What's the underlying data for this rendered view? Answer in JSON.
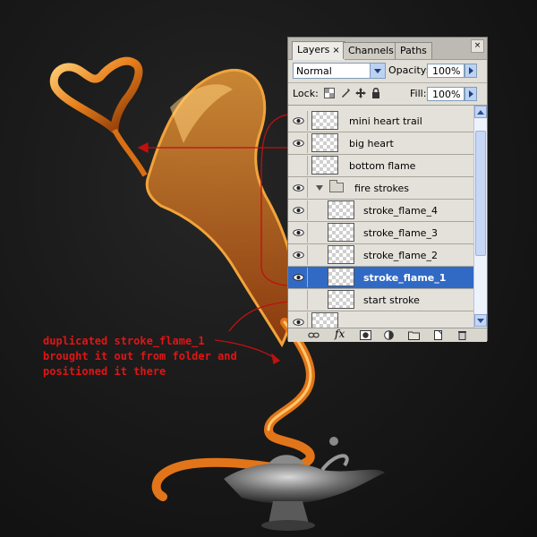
{
  "annotation": {
    "lines": [
      "duplicated stroke_flame_1",
      "brought it out from folder and",
      "positioned it there"
    ],
    "color": "#e01515"
  },
  "panel": {
    "tabs": [
      {
        "label": "Layers",
        "active": true,
        "close": "×"
      },
      {
        "label": "Channels",
        "active": false
      },
      {
        "label": "Paths",
        "active": false
      }
    ],
    "panel_close": "×",
    "blend_mode": "Normal",
    "opacity_label": "Opacity:",
    "opacity_value": "100%",
    "lock_label": "Lock:",
    "fill_label": "Fill:",
    "fill_value": "100%",
    "layers": [
      {
        "name": "mini heart trail",
        "visible": true,
        "selected": false
      },
      {
        "name": "big heart",
        "visible": true,
        "selected": false
      },
      {
        "name": "bottom flame",
        "visible": false,
        "selected": false
      },
      {
        "name": "fire strokes",
        "visible": true,
        "selected": false,
        "group": true
      },
      {
        "name": "stroke_flame_4",
        "visible": true,
        "selected": false,
        "indent": true
      },
      {
        "name": "stroke_flame_3",
        "visible": true,
        "selected": false,
        "indent": true
      },
      {
        "name": "stroke_flame_2",
        "visible": true,
        "selected": false,
        "indent": true
      },
      {
        "name": "stroke_flame_1",
        "visible": true,
        "selected": true,
        "indent": true
      },
      {
        "name": "start stroke",
        "visible": false,
        "selected": false,
        "indent": true
      }
    ],
    "bottom_icons": [
      "link-icon",
      "fx-icon",
      "mask-icon",
      "adjustment-icon",
      "new-group-icon",
      "new-layer-icon",
      "trash-icon"
    ],
    "fx_label": "fx",
    "selection_color": "#316ac5"
  }
}
